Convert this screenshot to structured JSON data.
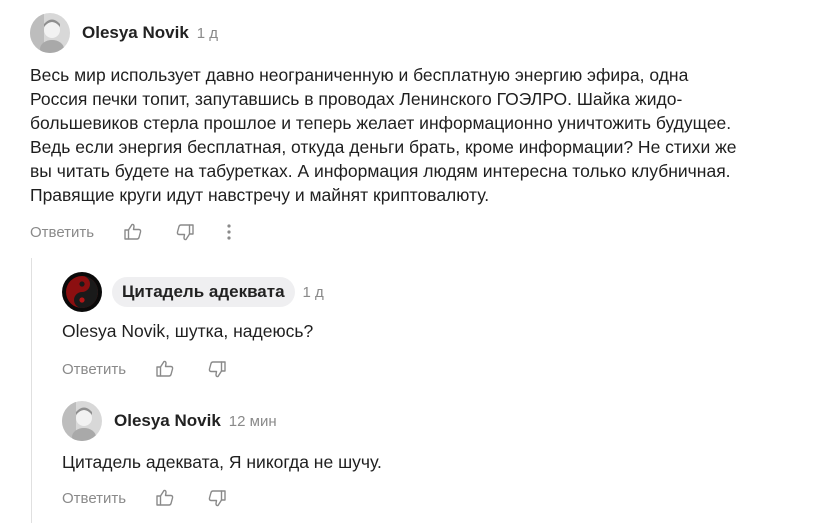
{
  "colors": {
    "text": "#1f1f1f",
    "meta": "#8a8a8a",
    "pill_bg": "#efeff1",
    "thread_line": "#e0e0e0"
  },
  "comments": [
    {
      "author": "Olesya Novik",
      "time": "1 д",
      "avatar_icon": "user-photo-avatar",
      "lines": [
        "Весь мир использует давно неограниченную и бесплатную энергию эфира, одна",
        "Россия печки топит, запутавшись в проводах Ленинского ГОЭЛРО. Шайка жидо-",
        "большевиков стерла прошлое и теперь желает информационно уничтожить будущее.",
        "Ведь если энергия бесплатная, откуда деньги брать, кроме информации? Не стихи же",
        "вы читать будете на табуретках. А информация людям интересна только клубничная.",
        "Правящие круги идут навстречу и майнят криптовалюту."
      ],
      "reply_label": "Ответить"
    },
    {
      "author": "Цитадель адеквата",
      "time": "1 д",
      "avatar_icon": "yin-yang-avatar",
      "text": "Olesya Novik, шутка, надеюсь?",
      "reply_label": "Ответить"
    },
    {
      "author": "Olesya Novik",
      "time": "12 мин",
      "avatar_icon": "user-photo-avatar",
      "text": "Цитадель адеквата, Я никогда не шучу.",
      "reply_label": "Ответить"
    }
  ]
}
